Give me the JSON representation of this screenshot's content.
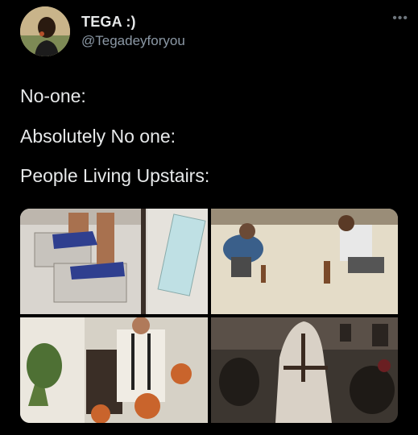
{
  "tweet": {
    "display_name": "TEGA :)",
    "handle": "@Tegadeyforyou",
    "more_icon": "more-horizontal-icon",
    "lines": [
      "No-one:",
      "Absolutely No one:",
      "People Living Upstairs:"
    ]
  },
  "media": {
    "items": [
      {
        "name": "media-cinderblock-shoes",
        "description_icon": "image-icon"
      },
      {
        "name": "media-hammering-floor",
        "description_icon": "image-icon"
      },
      {
        "name": "media-dribbling-basketballs",
        "description_icon": "image-icon"
      },
      {
        "name": "media-horse-indoors",
        "description_icon": "image-icon"
      }
    ]
  },
  "colors": {
    "background": "#000000",
    "text_primary": "#e7e9ea",
    "text_secondary": "#8b98a5"
  }
}
